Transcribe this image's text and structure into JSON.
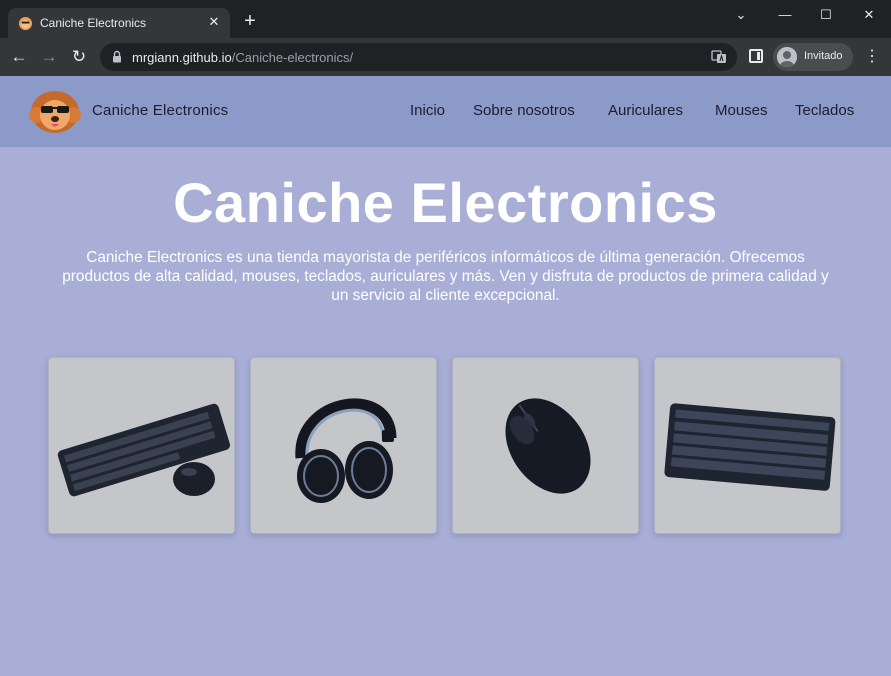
{
  "browser": {
    "tab_title": "Caniche Electronics",
    "url_host": "mrgiann.github.io",
    "url_path": "/Caniche-electronics/",
    "profile_label": "Invitado"
  },
  "site": {
    "brand": "Caniche Electronics",
    "nav": [
      {
        "label": "Inicio"
      },
      {
        "label": "Sobre nosotros"
      },
      {
        "label": "Auriculares"
      },
      {
        "label": "Mouses"
      },
      {
        "label": "Teclados"
      }
    ],
    "hero_title": "Caniche Electronics",
    "hero_description": "Caniche Electronics es una tienda mayorista de periféricos informáticos de última generación. Ofrecemos productos de alta calidad, mouses, teclados, auriculares y más. Ven y disfruta de productos de primera calidad y un servicio al cliente excepcional.",
    "products": [
      {
        "icon": "keyboard-and-mouse"
      },
      {
        "icon": "headphones"
      },
      {
        "icon": "mouse"
      },
      {
        "icon": "keyboard"
      }
    ]
  },
  "colors": {
    "page_bg": "#a9aed6",
    "header_bg": "#8c9ac9",
    "card_bg": "#c4c6c9"
  }
}
